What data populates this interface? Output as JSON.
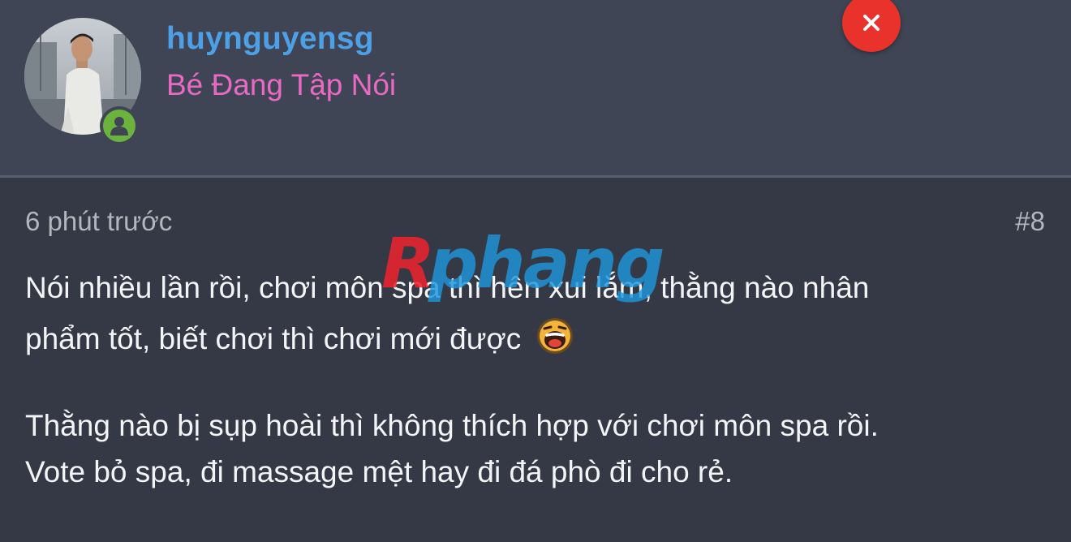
{
  "user": {
    "username": "huynguyensg",
    "title": "Bé Đang Tập Nói",
    "online": true
  },
  "icons": {
    "close": "close-icon",
    "online": "user-online-icon",
    "emoji": "laughing-emoji-icon"
  },
  "post": {
    "timestamp": "6 phút trước",
    "number": "#8",
    "lines": [
      "Nói nhiều lần rồi, chơi môn spa thì hên xui lắm, thằng nào nhân",
      "phẩm tốt, biết chơi thì chơi mới được",
      "Thằng nào bị sụp hoài thì không thích hợp với chơi môn spa rồi.",
      "Vote bỏ spa, đi massage mệt hay đi đá phò đi cho rẻ."
    ]
  },
  "watermark": {
    "first": "R",
    "rest": "phang"
  },
  "colors": {
    "username": "#4da0e6",
    "title": "#e86ac2",
    "close": "#e8322b",
    "online": "#6cb33e",
    "header_bg": "#404555",
    "body_bg": "#353945"
  }
}
